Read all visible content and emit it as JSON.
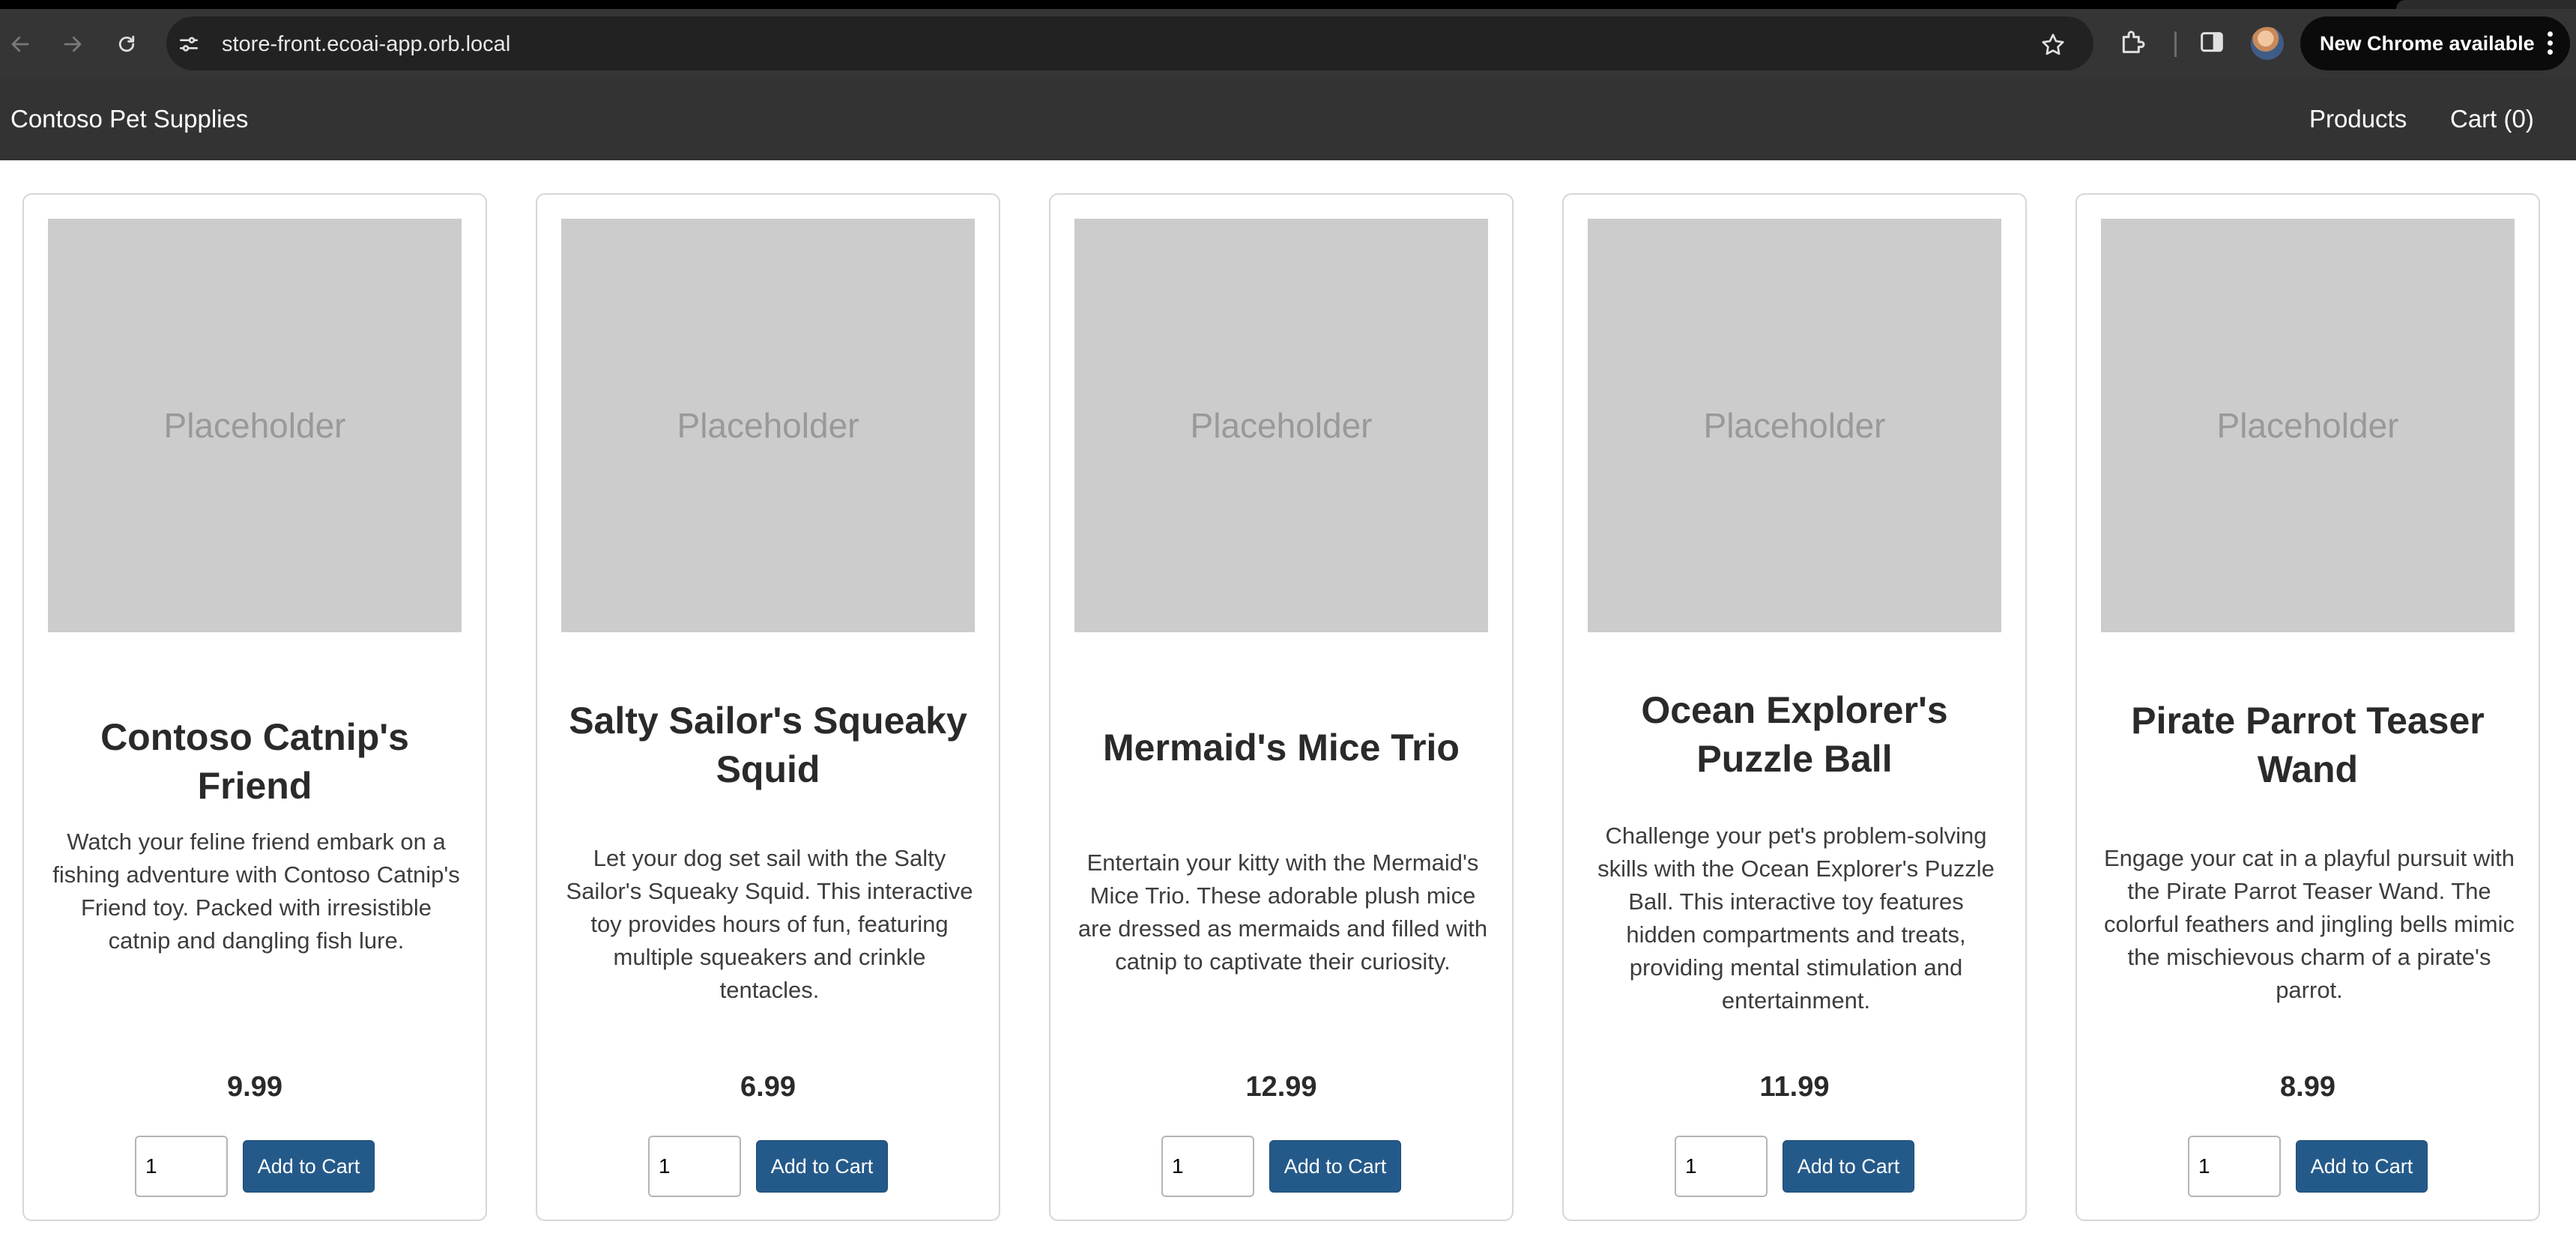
{
  "browser": {
    "url": "store-front.ecoai-app.orb.local",
    "update_banner": "New Chrome available"
  },
  "header": {
    "brand": "Contoso Pet Supplies",
    "nav": {
      "products": "Products",
      "cart": "Cart (0)"
    }
  },
  "products": [
    {
      "image_label": "Placeholder",
      "name": "Contoso Catnip's Friend",
      "description": "Watch your feline friend embark on a fishing adventure with Contoso Catnip's Friend toy. Packed with irresistible catnip and dangling fish lure.",
      "price": "9.99",
      "quantity": "1",
      "button_label": "Add to Cart"
    },
    {
      "image_label": "Placeholder",
      "name": "Salty Sailor's Squeaky Squid",
      "description": "Let your dog set sail with the Salty Sailor's Squeaky Squid. This interactive toy provides hours of fun, featuring multiple squeakers and crinkle tentacles.",
      "price": "6.99",
      "quantity": "1",
      "button_label": "Add to Cart"
    },
    {
      "image_label": "Placeholder",
      "name": "Mermaid's Mice Trio",
      "description": "Entertain your kitty with the Mermaid's Mice Trio. These adorable plush mice are dressed as mermaids and filled with catnip to captivate their curiosity.",
      "price": "12.99",
      "quantity": "1",
      "button_label": "Add to Cart"
    },
    {
      "image_label": "Placeholder",
      "name": "Ocean Explorer's Puzzle Ball",
      "description": "Challenge your pet's problem-solving skills with the Ocean Explorer's Puzzle Ball. This interactive toy features hidden compartments and treats, providing mental stimulation and entertainment.",
      "price": "11.99",
      "quantity": "1",
      "button_label": "Add to Cart"
    },
    {
      "image_label": "Placeholder",
      "name": "Pirate Parrot Teaser Wand",
      "description": "Engage your cat in a playful pursuit with the Pirate Parrot Teaser Wand. The colorful feathers and jingling bells mimic the mischievous charm of a pirate's parrot.",
      "price": "8.99",
      "quantity": "1",
      "button_label": "Add to Cart"
    }
  ]
}
